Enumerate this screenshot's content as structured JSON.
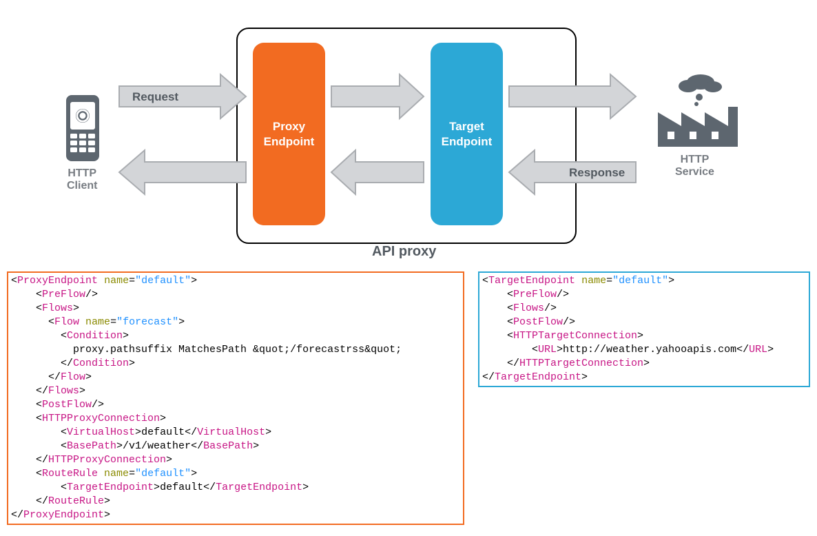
{
  "labels": {
    "httpClient": "HTTP\nClient",
    "request": "Request",
    "proxyEndpoint": "Proxy\nEndpoint",
    "targetEndpoint": "Target\nEndpoint",
    "apiProxy": "API proxy",
    "response": "Response",
    "httpService": "HTTP\nService"
  },
  "colors": {
    "proxy": "#f26b21",
    "target": "#2ca8d6",
    "arrow": "#d3d5d8",
    "arrowStroke": "#a9acb0",
    "icon": "#5d666f"
  },
  "code": {
    "proxy": {
      "root": "ProxyEndpoint",
      "rootAttr": "name",
      "rootVal": "\"default\"",
      "preflow": "PreFlow",
      "flows": "Flows",
      "flow": "Flow",
      "flowAttr": "name",
      "flowVal": "\"forecast\"",
      "condition": "Condition",
      "condText": "proxy.pathsuffix MatchesPath &quot;/forecastrss&quot;",
      "postflow": "PostFlow",
      "httpConn": "HTTPProxyConnection",
      "vhost": "VirtualHost",
      "vhostText": "default",
      "basepath": "BasePath",
      "basepathText": "/v1/weather",
      "routerule": "RouteRule",
      "routeAttr": "name",
      "routeVal": "\"default\"",
      "targetEp": "TargetEndpoint",
      "targetEpText": "default"
    },
    "target": {
      "root": "TargetEndpoint",
      "rootAttr": "name",
      "rootVal": "\"default\"",
      "preflow": "PreFlow",
      "flows": "Flows",
      "postflow": "PostFlow",
      "httpConn": "HTTPTargetConnection",
      "url": "URL",
      "urlText": "http://weather.yahooapis.com"
    }
  }
}
